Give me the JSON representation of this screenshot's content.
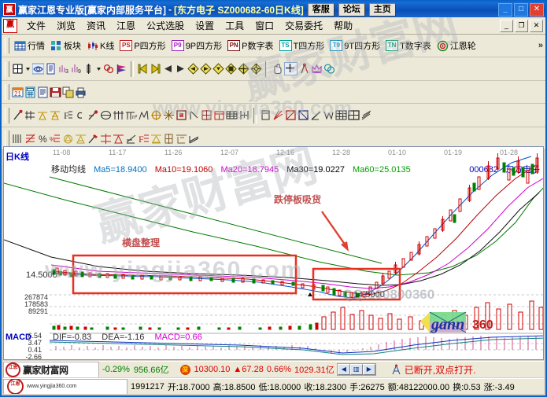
{
  "window": {
    "title_main": "赢家江恩专业版[赢家内部服务平台]",
    "title_dash": "-",
    "title_stock": "[东方电子    SZ000682-60日K线]",
    "buttons": [
      "客服",
      "论坛",
      "主页"
    ],
    "win_controls": [
      "_",
      "□",
      "✕"
    ]
  },
  "menubar": {
    "logo": "赢",
    "items": [
      "文件",
      "浏览",
      "资讯",
      "江恩",
      "公式选股",
      "设置",
      "工具",
      "窗口",
      "交易委托",
      "帮助"
    ],
    "mdi_controls": [
      "_",
      "❐",
      "✕"
    ]
  },
  "toolbar_main": {
    "items": [
      {
        "label": "行情",
        "icon": "grid-quote-icon"
      },
      {
        "label": "板块",
        "icon": "blocks-icon"
      },
      {
        "label": "K线",
        "icon": "candlestick-icon"
      },
      {
        "label": "P四方形",
        "icon": "ps-box-icon"
      },
      {
        "label": "9P四方形",
        "icon": "p9-box-icon"
      },
      {
        "label": "P数字表",
        "icon": "pn-box-icon"
      },
      {
        "label": "T四方形",
        "icon": "ts-box-icon"
      },
      {
        "label": "9T四方形",
        "icon": "t9-box-icon"
      },
      {
        "label": "T数字表",
        "icon": "tn-box-icon"
      },
      {
        "label": "江恩轮",
        "icon": "gann-wheel-icon"
      }
    ],
    "overflow": "»"
  },
  "toolbar_nav": {
    "icons": [
      "calendar-icon",
      "dropdown-arrow-icon",
      "eye-chart-icon",
      "report-icon",
      "ma3-icon",
      "ma9-icon",
      "vertical-bar-icon",
      "dropdown-arrow-2-icon",
      "knot-icon",
      "flag-icon",
      "first-icon",
      "last-icon",
      "prev-icon",
      "next-icon",
      "zoom-left-icon",
      "zoom-right-icon",
      "zoom-in-icon",
      "zoom-out-icon",
      "expand-icon",
      "move-icon",
      "hand-icon",
      "crosshair-icon",
      "compass-icon",
      "crown-icon",
      "brain-icon"
    ]
  },
  "toolbar_file": {
    "icons": [
      "calendar21-icon",
      "calculator-icon",
      "notes-icon",
      "save-icon",
      "copy-icon",
      "print-icon"
    ]
  },
  "toolbar_draw": {
    "icons": [
      "pen-icon",
      "gann-fan-icon",
      "gold-box1-icon",
      "gold-box2-icon",
      "fib-f-icon",
      "spiral-icon",
      "marker-icon",
      "ellipse-icon",
      "grid-lines-icon",
      "square-n2-icon",
      "wave-icon",
      "target-icon",
      "star-icon",
      "frame-icon",
      "trend-icon",
      "shen-icon",
      "ying-icon",
      "matrix-icon",
      "center-icon",
      "window-icon",
      "red-fan-icon",
      "red-box-icon",
      "blue-box-icon",
      "angle-icon",
      "valley-icon",
      "grid1-icon",
      "grid2-icon",
      "slopes-icon"
    ]
  },
  "toolbar_tools": {
    "icons": [
      "list-icon",
      "percent-cross-icon",
      "percent-icon",
      "percent-line-icon",
      "gold-circle1-icon",
      "gold-circle2-icon",
      "brush-icon",
      "red-cross-icon",
      "red-gold-icon",
      "angle2-icon",
      "red-f-icon",
      "gold-angle-icon",
      "shen2-icon",
      "ting-icon",
      "four-icon"
    ]
  },
  "chart": {
    "period_label": "日K线",
    "ma_title": "移动均线",
    "ma_values": [
      {
        "label": "Ma5=18.9400",
        "color": "#0070c0"
      },
      {
        "label": "Ma10=19.1060",
        "color": "#c00000"
      },
      {
        "label": "Ma20=18.7945",
        "color": "#d000d0"
      },
      {
        "label": "Ma30=19.0227",
        "color": "#000000"
      },
      {
        "label": "Ma60=25.0135",
        "color": "#00a000"
      }
    ],
    "stock_code": "000682",
    "stock_name": "东方电子",
    "dates": [
      "11-08",
      "11-17",
      "11-26",
      "12-07",
      "12-16",
      "12-28",
      "01-10",
      "01-19",
      "01-28"
    ],
    "price_axis_label": "14.5000",
    "price_marker": "14.5000",
    "volume_axis": [
      "267874",
      "178583",
      "89291"
    ],
    "annotations": [
      {
        "text": "横盘整理",
        "color": "#c05050"
      },
      {
        "text": "跌停板吸货",
        "color": "#c05050"
      }
    ]
  },
  "macd": {
    "label": "MACD",
    "values": [
      {
        "label": "DIF=-0.83",
        "color": "#303030"
      },
      {
        "label": "DEA=-1.16",
        "color": "#303030"
      },
      {
        "label": "MACD=0.66",
        "color": "#d000d0"
      }
    ],
    "scale": [
      "6.54",
      "3.47",
      "0.41",
      "-2.66"
    ]
  },
  "statusbar": {
    "brand": "赢家财富网",
    "brand_seal": "江恩",
    "index_change_pct": "-0.29%",
    "index_amount": "956.66亿",
    "sz_badge": "深",
    "sz_value": "10300.10",
    "sz_arrow": "▲",
    "sz_change": "67.28",
    "sz_pct": "0.66%",
    "sz_amount": "1029.31亿",
    "scroll_left": "◀",
    "scroll_mid": "▥",
    "scroll_right": "▶",
    "conn_icon": "antenna-icon",
    "conn_text": "已断开,双点打开."
  },
  "bottombar": {
    "brand_url": "www.yingjia360.com",
    "date": "1991217",
    "fields": [
      "开:18.7000",
      "高:18.8500",
      "低:18.0000",
      "收:18.2300",
      "手:26275",
      "额:48122000.00",
      "换:0.53",
      "涨:-3.49"
    ]
  },
  "watermarks": {
    "big": "赢家财富网",
    "url": "www.yingjia360.com",
    "qq": "QQ:100800360",
    "gann": "gann360"
  },
  "colors": {
    "titlebar": "#0a56c0",
    "menubg": "#ece9d8",
    "chart_bg": "#ffffff",
    "up_red": "#e00000",
    "down_green": "#008000",
    "annotation": "#c05050",
    "box_red": "#e03030"
  }
}
